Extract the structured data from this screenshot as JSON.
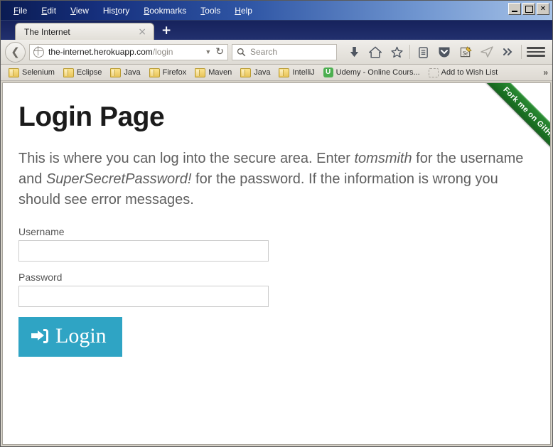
{
  "window": {
    "controls": [
      {
        "name": "minimize",
        "glyph": "_"
      },
      {
        "name": "maximize",
        "glyph": "□"
      },
      {
        "name": "close",
        "glyph": "×"
      }
    ]
  },
  "menubar": {
    "items": [
      {
        "label": "File",
        "accel": "F"
      },
      {
        "label": "Edit",
        "accel": "E"
      },
      {
        "label": "View",
        "accel": "V"
      },
      {
        "label": "History",
        "accel": "t"
      },
      {
        "label": "Bookmarks",
        "accel": "B"
      },
      {
        "label": "Tools",
        "accel": "T"
      },
      {
        "label": "Help",
        "accel": "H"
      }
    ]
  },
  "tabs": {
    "active_title": "The Internet",
    "close_glyph": "×",
    "new_tab_glyph": "＋"
  },
  "navbar": {
    "back_glyph": "←",
    "url_host": "the-internet.herokuapp.com",
    "url_path": "/login",
    "url_dropdown_glyph": "▼",
    "reload_glyph": "⟳",
    "search_placeholder": "Search",
    "search_icon_glyph": "⚲",
    "icons": [
      {
        "name": "downloads-icon",
        "glyph": "⬇"
      },
      {
        "name": "home-icon",
        "glyph": "⌂"
      },
      {
        "name": "bookmark-star-icon",
        "glyph": "☆"
      },
      {
        "name": "reading-list-icon",
        "glyph": "Ὄb"
      },
      {
        "name": "pocket-shield-icon",
        "glyph": "▽"
      },
      {
        "name": "selenium-ide-icon",
        "glyph": "Se"
      },
      {
        "name": "send-tab-icon",
        "glyph": "➤"
      },
      {
        "name": "overflow-chevrons-icon",
        "glyph": "»"
      }
    ]
  },
  "bookmarks": {
    "items": [
      {
        "label": "Selenium",
        "icon": "folder"
      },
      {
        "label": "Eclipse",
        "icon": "folder"
      },
      {
        "label": "Java",
        "icon": "folder"
      },
      {
        "label": "Firefox",
        "icon": "folder"
      },
      {
        "label": "Maven",
        "icon": "folder"
      },
      {
        "label": "Java",
        "icon": "folder"
      },
      {
        "label": "IntelliJ",
        "icon": "folder"
      },
      {
        "label": "Udemy - Online Cours...",
        "icon": "udemy"
      },
      {
        "label": "Add to Wish List",
        "icon": "dashed"
      }
    ],
    "overflow_glyph": "»"
  },
  "page": {
    "ribbon_text": "Fork me on GitHub",
    "title": "Login Page",
    "intro": {
      "part1": "This is where you can log into the secure area. Enter ",
      "username_em": "tomsmith",
      "part2": " for the username and ",
      "password_em": "SuperSecretPassword!",
      "part3": " for the password. If the information is wrong you should see error messages."
    },
    "form": {
      "username_label": "Username",
      "username_value": "",
      "username_placeholder": "",
      "password_label": "Password",
      "password_value": "",
      "password_placeholder": "",
      "submit_label": "Login"
    }
  },
  "colors": {
    "accent_button": "#2fa4c4",
    "ribbon_green": "#1a7521",
    "titlebar_navy": "#16307e",
    "udemy_green": "#4caf50"
  }
}
